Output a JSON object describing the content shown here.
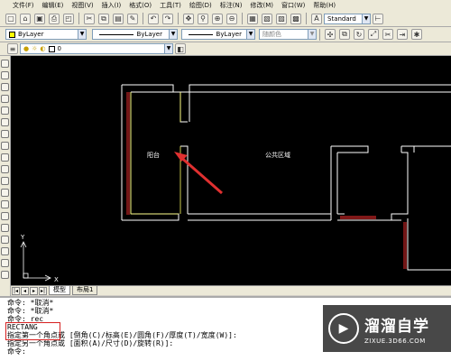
{
  "menu": [
    "文件(F)",
    "编辑(E)",
    "视图(V)",
    "插入(I)",
    "格式(O)",
    "工具(T)",
    "绘图(D)",
    "标注(N)",
    "修改(M)",
    "窗口(W)",
    "帮助(H)"
  ],
  "toolbar": {
    "text_style": "Standard",
    "color": "ByLayer",
    "linetype": "ByLayer",
    "lineweight": "ByLayer",
    "plotstyle": "随颜色",
    "layer_value": "0",
    "color_swatch": "#ffff00"
  },
  "drawing": {
    "room1": "阳台",
    "room2": "公共区域",
    "ucs_x": "X",
    "ucs_y": "Y"
  },
  "tabs": {
    "model": "模型",
    "layout": "布局1"
  },
  "command_lines": [
    "命令: *取消*",
    "命令: *取消*",
    "命令: rec",
    "RECTANG",
    "指定第一个角点或 [倒角(C)/标高(E)/圆角(F)/厚度(T)/宽度(W)]:",
    "指定另一个角点或 [面积(A)/尺寸(D)/旋转(R)]:",
    "命令:"
  ],
  "watermark": {
    "title": "溜溜自学",
    "url": "ZIXUE.3D66.COM"
  },
  "colors": {
    "canvas": "#000000",
    "line": "#ffffff",
    "accent_line": "#ff0000",
    "highlight": "#ffff66"
  }
}
